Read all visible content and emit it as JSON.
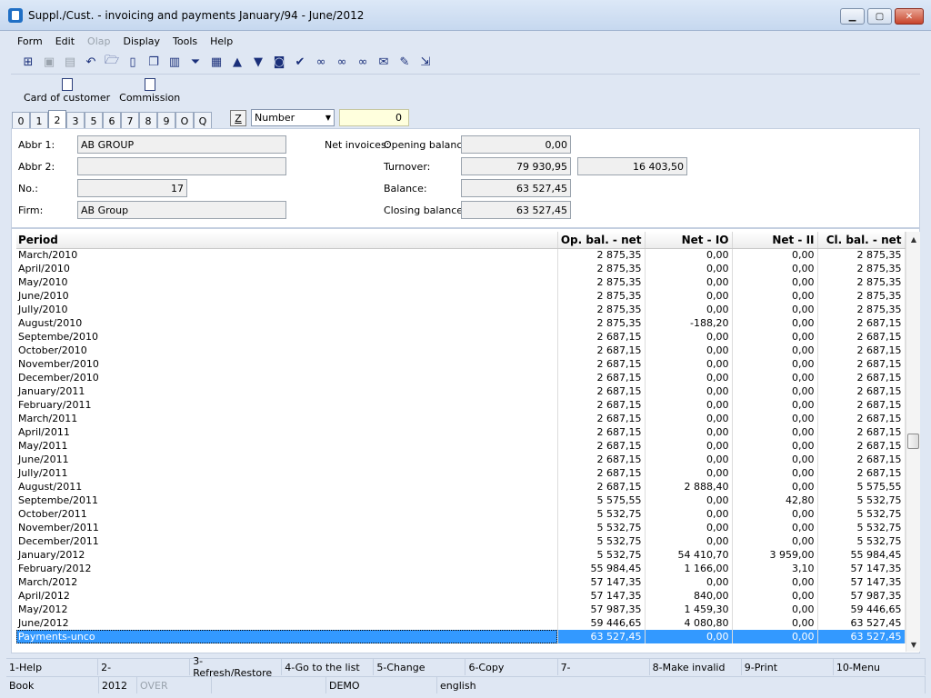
{
  "window": {
    "title": "Suppl./Cust. - invoicing and payments    January/94    - June/2012"
  },
  "menu": [
    {
      "label": "Form",
      "disabled": false
    },
    {
      "label": "Edit",
      "disabled": false
    },
    {
      "label": "Olap",
      "disabled": true
    },
    {
      "label": "Display",
      "disabled": false
    },
    {
      "label": "Tools",
      "disabled": false
    },
    {
      "label": "Help",
      "disabled": false
    }
  ],
  "toolbar_icons": [
    "tree-icon",
    "save-icon",
    "save-as-icon",
    "undo-icon",
    "open-folder-icon",
    "new-document-icon",
    "copy-icon",
    "book-icon",
    "filter-icon",
    "filter-doc-icon",
    "arrow-up-icon",
    "arrow-down-icon",
    "camera-icon",
    "check-run-icon",
    "binoculars-icon",
    "binoculars-next-icon",
    "binoculars-prev-icon",
    "mail-icon",
    "notes-icon",
    "export-icon"
  ],
  "ribbon": {
    "card_label": "Card of customer",
    "commission_label": "Commission"
  },
  "tabs": [
    "0",
    "1",
    "2",
    "3",
    "5",
    "6",
    "7",
    "8",
    "9",
    "O",
    "Q"
  ],
  "active_tab": "2",
  "sort": {
    "z_label": "Z",
    "selected": "Number",
    "value": "0"
  },
  "header": {
    "abbr1_label": "Abbr 1:",
    "abbr1": "AB GROUP",
    "abbr2_label": "Abbr 2:",
    "abbr2": "",
    "no_label": "No.:",
    "no": "17",
    "firm_label": "Firm:",
    "firm": "AB Group",
    "net_invoices_label": "Net invoices:",
    "opening_label": "Opening balance:",
    "opening": "0,00",
    "turnover_label": "Turnover:",
    "turnover1": "79 930,95",
    "turnover2": "16 403,50",
    "balance_label": "Balance:",
    "balance": "63 527,45",
    "closing_label": "Closing balance:",
    "closing": "63 527,45"
  },
  "table": {
    "columns": [
      "Period",
      "Op. bal. - net",
      "Net - IO",
      "Net - II",
      "Cl. bal. - net"
    ],
    "rows": [
      [
        "March/2010",
        "2 875,35",
        "0,00",
        "0,00",
        "2 875,35"
      ],
      [
        "April/2010",
        "2 875,35",
        "0,00",
        "0,00",
        "2 875,35"
      ],
      [
        "May/2010",
        "2 875,35",
        "0,00",
        "0,00",
        "2 875,35"
      ],
      [
        "June/2010",
        "2 875,35",
        "0,00",
        "0,00",
        "2 875,35"
      ],
      [
        "Jully/2010",
        "2 875,35",
        "0,00",
        "0,00",
        "2 875,35"
      ],
      [
        "August/2010",
        "2 875,35",
        "-188,20",
        "0,00",
        "2 687,15"
      ],
      [
        "Septembe/2010",
        "2 687,15",
        "0,00",
        "0,00",
        "2 687,15"
      ],
      [
        "October/2010",
        "2 687,15",
        "0,00",
        "0,00",
        "2 687,15"
      ],
      [
        "November/2010",
        "2 687,15",
        "0,00",
        "0,00",
        "2 687,15"
      ],
      [
        "December/2010",
        "2 687,15",
        "0,00",
        "0,00",
        "2 687,15"
      ],
      [
        "January/2011",
        "2 687,15",
        "0,00",
        "0,00",
        "2 687,15"
      ],
      [
        "February/2011",
        "2 687,15",
        "0,00",
        "0,00",
        "2 687,15"
      ],
      [
        "March/2011",
        "2 687,15",
        "0,00",
        "0,00",
        "2 687,15"
      ],
      [
        "April/2011",
        "2 687,15",
        "0,00",
        "0,00",
        "2 687,15"
      ],
      [
        "May/2011",
        "2 687,15",
        "0,00",
        "0,00",
        "2 687,15"
      ],
      [
        "June/2011",
        "2 687,15",
        "0,00",
        "0,00",
        "2 687,15"
      ],
      [
        "Jully/2011",
        "2 687,15",
        "0,00",
        "0,00",
        "2 687,15"
      ],
      [
        "August/2011",
        "2 687,15",
        "2 888,40",
        "0,00",
        "5 575,55"
      ],
      [
        "Septembe/2011",
        "5 575,55",
        "0,00",
        "42,80",
        "5 532,75"
      ],
      [
        "October/2011",
        "5 532,75",
        "0,00",
        "0,00",
        "5 532,75"
      ],
      [
        "November/2011",
        "5 532,75",
        "0,00",
        "0,00",
        "5 532,75"
      ],
      [
        "December/2011",
        "5 532,75",
        "0,00",
        "0,00",
        "5 532,75"
      ],
      [
        "January/2012",
        "5 532,75",
        "54 410,70",
        "3 959,00",
        "55 984,45"
      ],
      [
        "February/2012",
        "55 984,45",
        "1 166,00",
        "3,10",
        "57 147,35"
      ],
      [
        "March/2012",
        "57 147,35",
        "0,00",
        "0,00",
        "57 147,35"
      ],
      [
        "April/2012",
        "57 147,35",
        "840,00",
        "0,00",
        "57 987,35"
      ],
      [
        "May/2012",
        "57 987,35",
        "1 459,30",
        "0,00",
        "59 446,65"
      ],
      [
        "June/2012",
        "59 446,65",
        "4 080,80",
        "0,00",
        "63 527,45"
      ],
      [
        "Payments-unco",
        "63 527,45",
        "0,00",
        "0,00",
        "63 527,45"
      ]
    ],
    "selected_row": 28
  },
  "fkeys": [
    "1-Help",
    "2-",
    "3-Refresh/Restore",
    "4-Go to the list",
    "5-Change",
    "6-Copy",
    "7-",
    "8-Make invalid",
    "9-Print",
    "10-Menu"
  ],
  "status": {
    "book": "Book",
    "year": "2012",
    "over": "OVER",
    "db": "DEMO",
    "lang": "english"
  },
  "colors": {
    "selection": "#3399ff",
    "search_bg": "#ffffdd"
  }
}
